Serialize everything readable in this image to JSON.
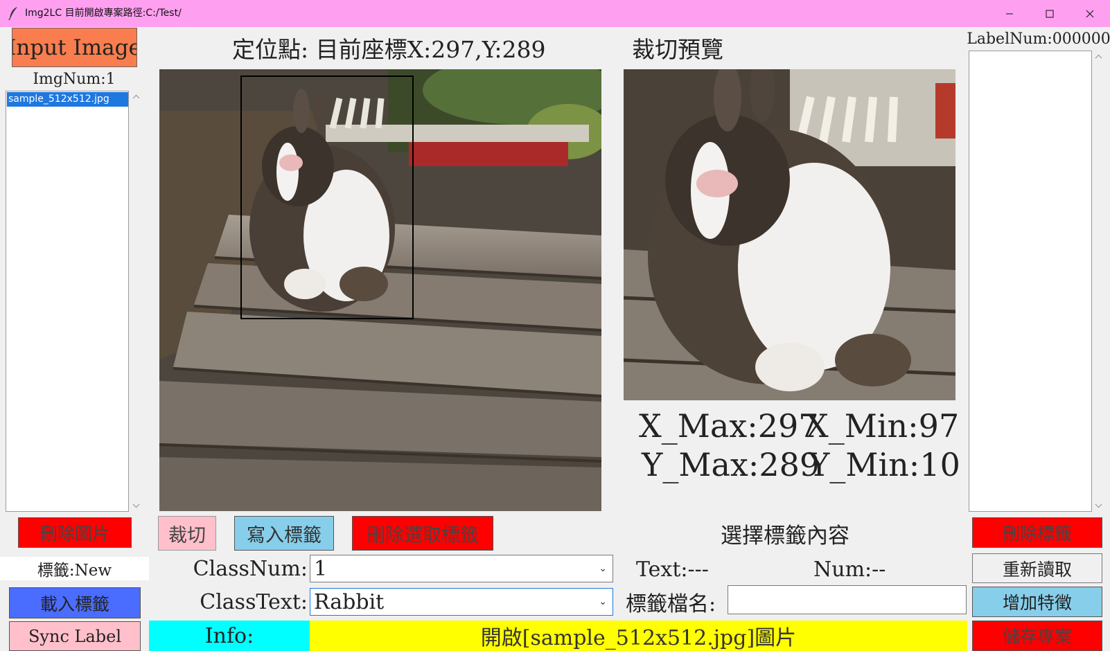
{
  "window": {
    "title": "Img2LC 目前開啟專案路徑:C:/Test/",
    "icon": "feather-icon",
    "titlebar_color": "#ff9ff0"
  },
  "left": {
    "input_button": "Input Image",
    "img_count": "ImgNum:1",
    "files": [
      "sample_512x512.jpg"
    ],
    "delete_image_button": "刪除圖片",
    "label_status": "標籤:New",
    "load_labels_button": "載入標籤",
    "sync_label_button": "Sync Label"
  },
  "center": {
    "position_label": "定位點: 目前座標X:297,Y:289",
    "crop_button": "裁切",
    "write_label_button": "寫入標籤",
    "delete_selected_button": "刪除選取標籤",
    "classnum_label": "ClassNum:",
    "classnum_value": "1",
    "classtext_label": "ClassText:",
    "classtext_value": "Rabbit",
    "info_label": "Info:",
    "info_message": "開啟[sample_512x512.jpg]圖片"
  },
  "preview": {
    "title": "裁切預覽",
    "xmax_label": "X_Max:297",
    "xmin_label": "X_Min:97",
    "ymax_label": "Y_Max:289",
    "ymin_label": "Y_Min:10",
    "select_label_title": "選擇標籤內容",
    "text_field": "Text:---",
    "num_field": "Num:--",
    "label_filename_label": "標籤檔名:",
    "label_filename_value": ""
  },
  "right": {
    "label_count": "LabelNum:000000",
    "delete_label_button": "刪除標籤",
    "reload_button": "重新讀取",
    "add_feature_button": "增加特徵",
    "save_project_button": "儲存專案"
  },
  "colors": {
    "input_button": "#f97d4e",
    "red_button": "#ff0000",
    "pink_button": "#ffc0cb",
    "sky_button": "#87ceeb",
    "blue_button": "#4a6cff",
    "info_label_bg": "#00ffff",
    "info_bg": "#ffff00"
  }
}
